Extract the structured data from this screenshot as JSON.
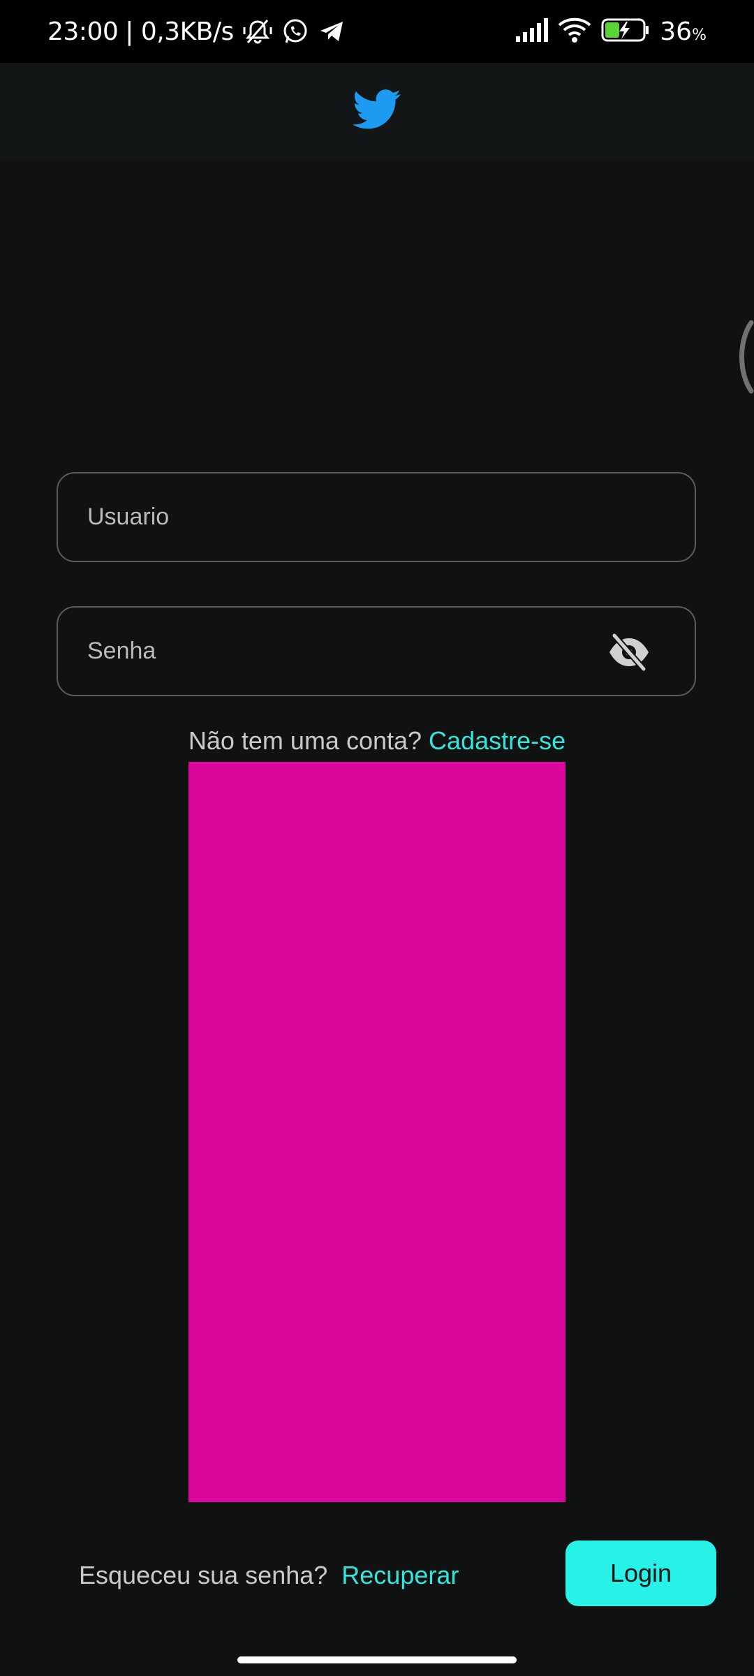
{
  "status_bar": {
    "time": "23:00",
    "network_speed": "| 0,3KB/s",
    "battery_level": "36",
    "battery_unit": "%",
    "icons": [
      "mute-icon",
      "whatsapp-icon",
      "telegram-icon",
      "signal-icon",
      "wifi-icon",
      "battery-charging-icon"
    ]
  },
  "app_bar": {
    "logo_icon": "twitter-bird-icon",
    "logo_color": "#1d9bf0"
  },
  "form": {
    "username_placeholder": "Usuario",
    "username_value": "",
    "password_placeholder": "Senha",
    "password_value": "",
    "visibility_icon": "eye-off-icon"
  },
  "signup": {
    "prompt": "Não tem uma conta? ",
    "link_label": "Cadastre-se"
  },
  "magenta_block_color": "#db069c",
  "footer": {
    "forgot_prompt": "Esqueceu sua senha?",
    "recover_label": "Recuperar",
    "login_label": "Login"
  },
  "colors": {
    "background": "#101212",
    "accent": "#32e6dc",
    "login_button": "#28f2e7"
  }
}
